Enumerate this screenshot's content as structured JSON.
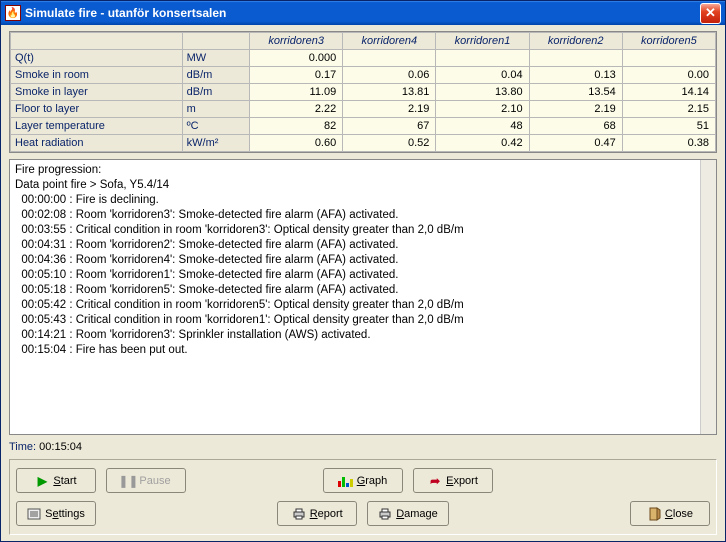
{
  "window": {
    "title": "Simulate fire - utanför konsertsalen"
  },
  "table": {
    "columns": [
      "korridoren3",
      "korridoren4",
      "korridoren1",
      "korridoren2",
      "korridoren5"
    ],
    "rows": [
      {
        "label": "Q(t)",
        "unit": "MW",
        "values": [
          "0.000",
          "",
          "",
          "",
          ""
        ]
      },
      {
        "label": "Smoke in room",
        "unit": "dB/m",
        "values": [
          "0.17",
          "0.06",
          "0.04",
          "0.13",
          "0.00"
        ]
      },
      {
        "label": "Smoke in layer",
        "unit": "dB/m",
        "values": [
          "11.09",
          "13.81",
          "13.80",
          "13.54",
          "14.14"
        ]
      },
      {
        "label": "Floor to layer",
        "unit": "m",
        "values": [
          "2.22",
          "2.19",
          "2.10",
          "2.19",
          "2.15"
        ]
      },
      {
        "label": "Layer temperature",
        "unit": "ºC",
        "values": [
          "82",
          "67",
          "48",
          "68",
          "51"
        ]
      },
      {
        "label": "Heat radiation",
        "unit": "kW/m²",
        "values": [
          "0.60",
          "0.52",
          "0.42",
          "0.47",
          "0.38"
        ]
      }
    ]
  },
  "log": "Fire progression:\nData point fire > Sofa, Y5.4/14\n  00:00:00 : Fire is declining.\n  00:02:08 : Room 'korridoren3': Smoke-detected fire alarm (AFA) activated.\n  00:03:55 : Critical condition in room 'korridoren3': Optical density greater than 2,0 dB/m\n  00:04:31 : Room 'korridoren2': Smoke-detected fire alarm (AFA) activated.\n  00:04:36 : Room 'korridoren4': Smoke-detected fire alarm (AFA) activated.\n  00:05:10 : Room 'korridoren1': Smoke-detected fire alarm (AFA) activated.\n  00:05:18 : Room 'korridoren5': Smoke-detected fire alarm (AFA) activated.\n  00:05:42 : Critical condition in room 'korridoren5': Optical density greater than 2,0 dB/m\n  00:05:43 : Critical condition in room 'korridoren1': Optical density greater than 2,0 dB/m\n  00:14:21 : Room 'korridoren3': Sprinkler installation (AWS) activated.\n  00:15:04 : Fire has been put out.",
  "time": {
    "label": "Time:",
    "value": "00:15:04"
  },
  "buttons": {
    "start": "Start",
    "pause": "Pause",
    "graph": "Graph",
    "export": "Export",
    "settings": "Settings",
    "report": "Report",
    "damage": "Damage",
    "close": "Close"
  }
}
